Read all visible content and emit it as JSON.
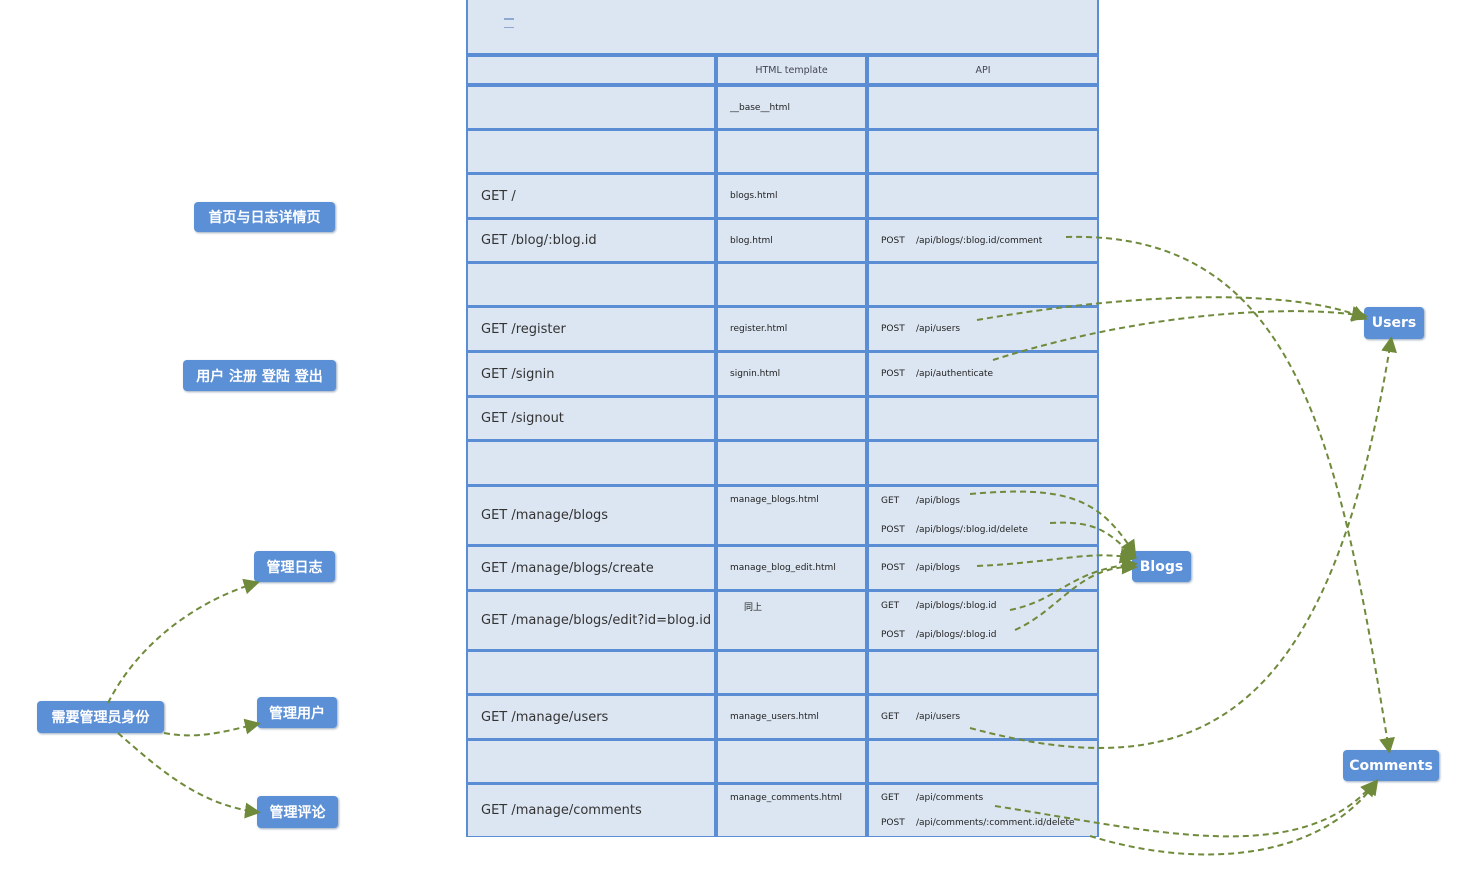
{
  "colors": {
    "table_border": "#5b8dd4",
    "cell_bg": "#dce6f2",
    "tag_bg": "#5b8fd6",
    "arrow": "#6f8a3a"
  },
  "table_icon": "table-insert-icon",
  "header": {
    "col1": "HTML template",
    "col2": "API"
  },
  "rows": [
    {
      "route": "",
      "template": "__base__html",
      "api": []
    },
    {
      "route": "",
      "template": "",
      "api": []
    },
    {
      "route": "GET /",
      "template": "blogs.html",
      "api": []
    },
    {
      "route": "GET /blog/:blog.id",
      "template": "blog.html",
      "api": [
        {
          "m": "POST",
          "p": "/api/blogs/:blog.id/comment"
        }
      ]
    },
    {
      "route": "",
      "template": "",
      "api": []
    },
    {
      "route": "GET /register",
      "template": "register.html",
      "api": [
        {
          "m": "POST",
          "p": "/api/users"
        }
      ]
    },
    {
      "route": "GET /signin",
      "template": "signin.html",
      "api": [
        {
          "m": "POST",
          "p": "/api/authenticate"
        }
      ]
    },
    {
      "route": "GET /signout",
      "template": "",
      "api": []
    },
    {
      "route": "",
      "template": "",
      "api": []
    },
    {
      "route": "GET /manage/blogs",
      "template": "manage_blogs.html",
      "api": [
        {
          "m": "GET",
          "p": "/api/blogs"
        },
        {
          "m": "POST",
          "p": "/api/blogs/:blog.id/delete"
        }
      ]
    },
    {
      "route": "GET /manage/blogs/create",
      "template": "manage_blog_edit.html",
      "api": [
        {
          "m": "POST",
          "p": "/api/blogs"
        }
      ]
    },
    {
      "route": "GET /manage/blogs/edit?id=blog.id",
      "template": "同上",
      "api": [
        {
          "m": "GET",
          "p": "/api/blogs/:blog.id"
        },
        {
          "m": "POST",
          "p": "/api/blogs/:blog.id"
        }
      ]
    },
    {
      "route": "",
      "template": "",
      "api": []
    },
    {
      "route": "GET /manage/users",
      "template": "manage_users.html",
      "api": [
        {
          "m": "GET",
          "p": "/api/users"
        }
      ]
    },
    {
      "route": "",
      "template": "",
      "api": []
    },
    {
      "route": "GET /manage/comments",
      "template": "manage_comments.html",
      "api": [
        {
          "m": "GET",
          "p": "/api/comments"
        },
        {
          "m": "POST",
          "p": "/api/comments/:comment.id/delete"
        }
      ]
    }
  ],
  "left_tags": {
    "home": "首页与日志详情页",
    "user": "用户 注册 登陆 登出",
    "manage_blogs": "管理日志",
    "admin": "需要管理员身份",
    "manage_users": "管理用户",
    "manage_comments": "管理评论"
  },
  "right_tags": {
    "users": "Users",
    "blogs": "Blogs",
    "comments": "Comments"
  }
}
